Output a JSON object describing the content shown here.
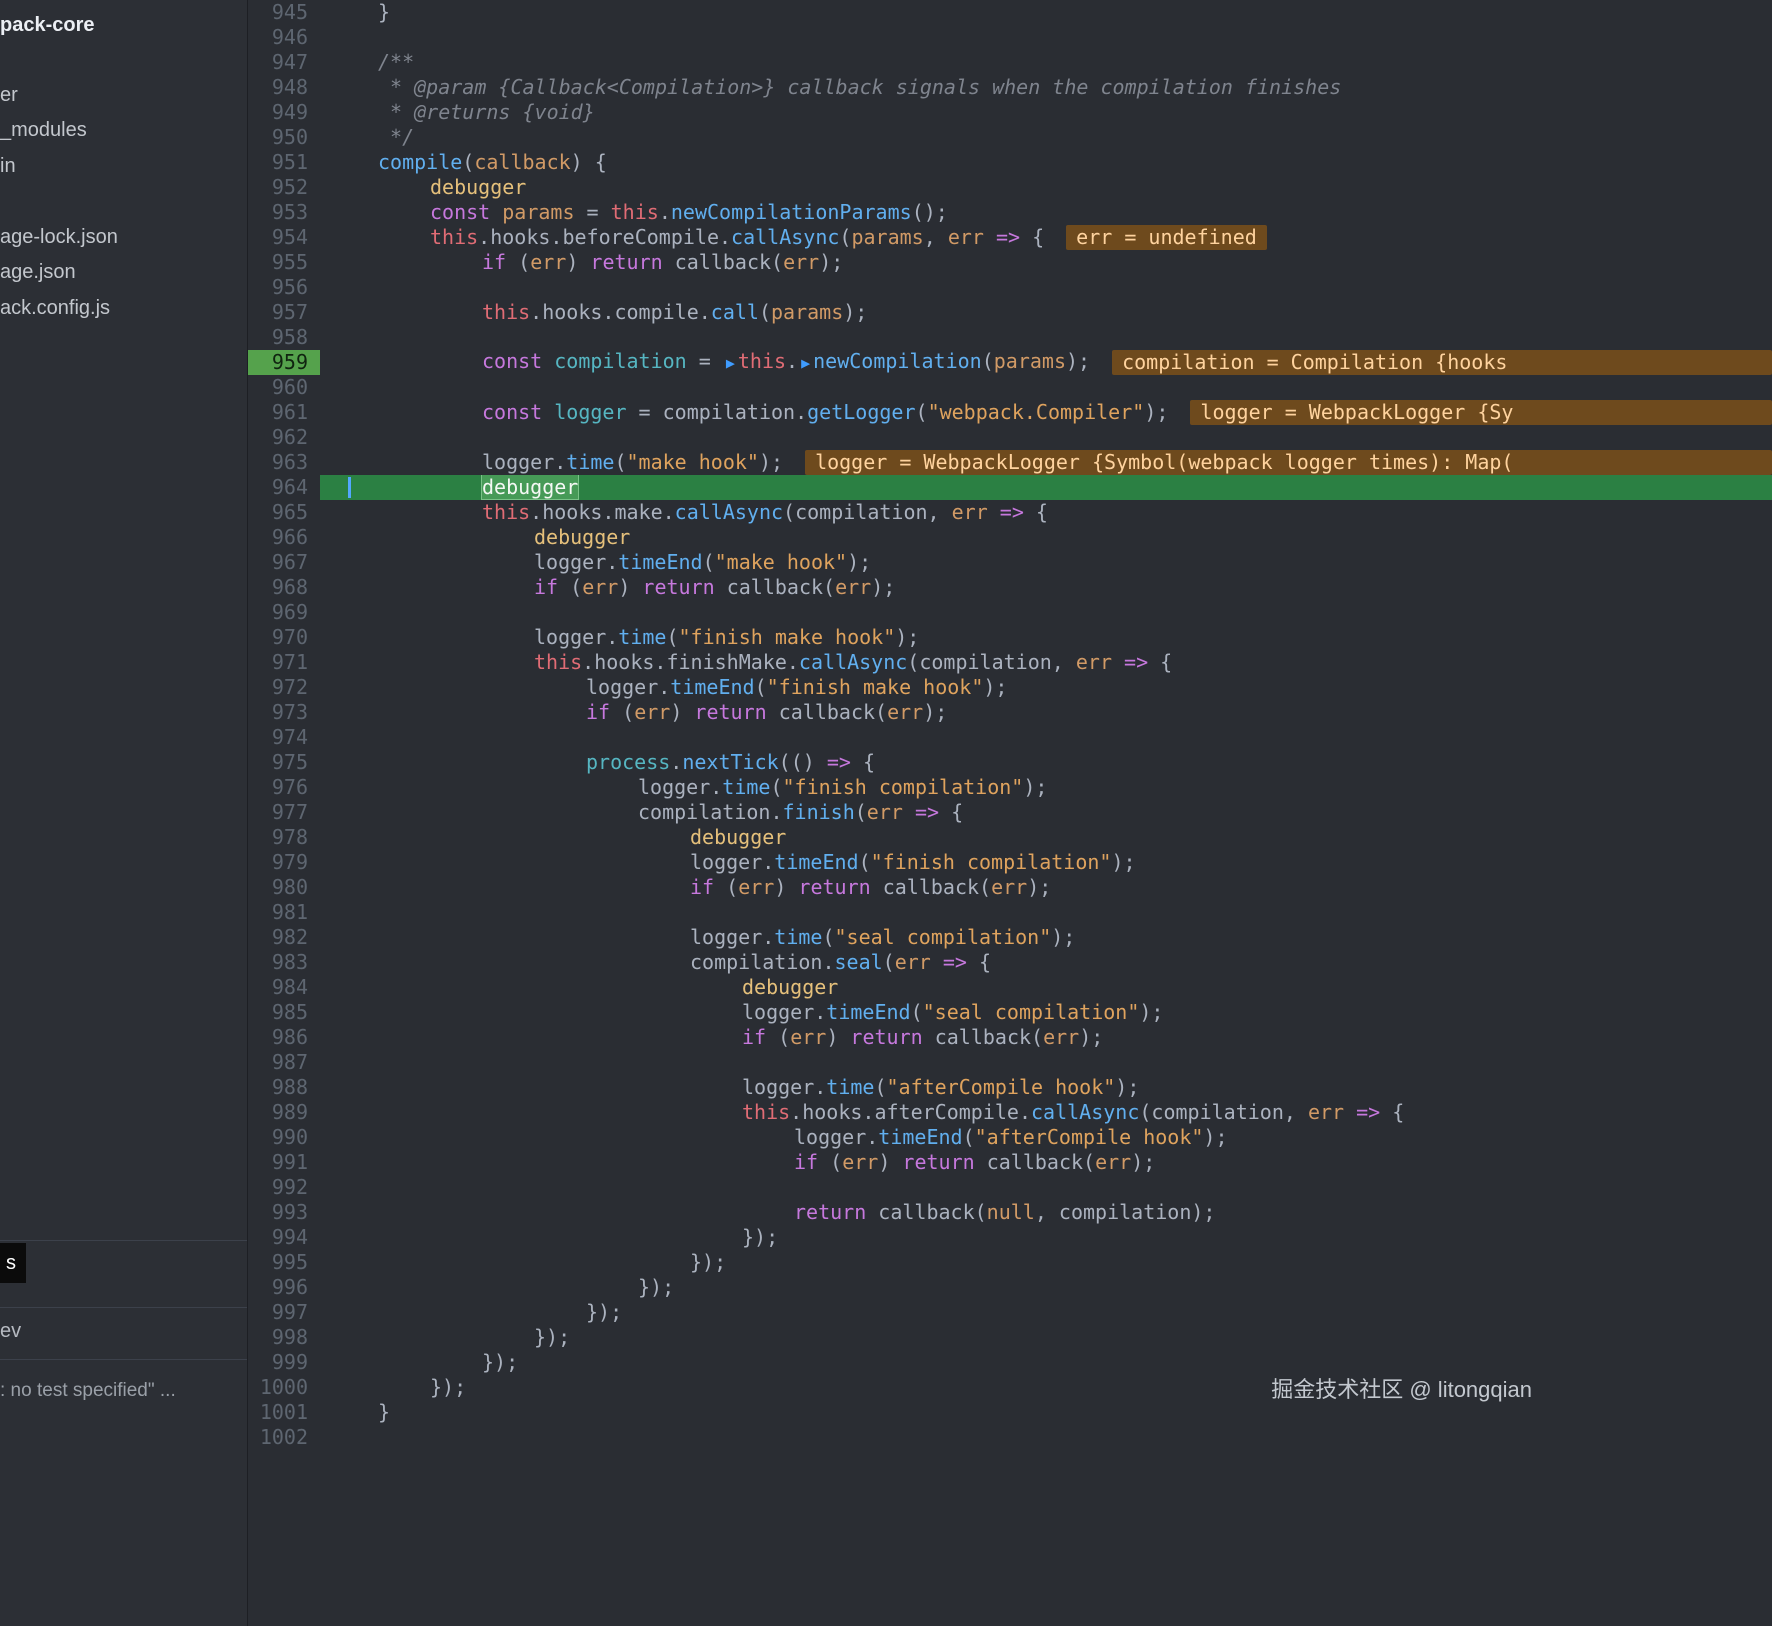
{
  "watermark": "掘金技术社区 @ litongqian",
  "sidebar": {
    "items": [
      {
        "label": "pack-core",
        "bold": true
      },
      {
        "label": "er"
      },
      {
        "label": "_modules"
      },
      {
        "label": "in"
      },
      {
        "label": "age-lock.json"
      },
      {
        "label": "age.json"
      },
      {
        "label": "ack.config.js"
      }
    ],
    "bottom": {
      "tab_label": "s",
      "script_label": "ev",
      "test_label": ": no test specified\" ..."
    }
  },
  "editor": {
    "lines": [
      {
        "n": 945,
        "ind": 1,
        "t": [
          [
            "p",
            "}"
          ]
        ]
      },
      {
        "n": 946,
        "ind": 0,
        "t": []
      },
      {
        "n": 947,
        "ind": 1,
        "t": [
          [
            "cm",
            "/**"
          ]
        ]
      },
      {
        "n": 948,
        "ind": 1,
        "t": [
          [
            "cm",
            " * @param {Callback<Compilation>} callback signals when the compilation finishes"
          ]
        ]
      },
      {
        "n": 949,
        "ind": 1,
        "t": [
          [
            "cm",
            " * @returns {void}"
          ]
        ]
      },
      {
        "n": 950,
        "ind": 1,
        "t": [
          [
            "cm",
            " */"
          ]
        ]
      },
      {
        "n": 951,
        "ind": 1,
        "t": [
          [
            "f",
            "compile"
          ],
          [
            "p",
            "("
          ],
          [
            "o",
            "callback"
          ],
          [
            "p",
            ") {"
          ]
        ]
      },
      {
        "n": 952,
        "ind": 2,
        "t": [
          [
            "d",
            "debugger"
          ]
        ]
      },
      {
        "n": 953,
        "ind": 2,
        "t": [
          [
            "k",
            "const"
          ],
          [
            "p",
            " "
          ],
          [
            "o",
            "params"
          ],
          [
            "p",
            " = "
          ],
          [
            "t",
            "this"
          ],
          [
            "p",
            "."
          ],
          [
            "f",
            "newCompilationParams"
          ],
          [
            "p",
            "();"
          ]
        ]
      },
      {
        "n": 954,
        "ind": 2,
        "t": [
          [
            "t",
            "this"
          ],
          [
            "p",
            ".hooks.beforeCompile."
          ],
          [
            "f",
            "callAsync"
          ],
          [
            "p",
            "("
          ],
          [
            "o",
            "params"
          ],
          [
            "p",
            ", "
          ],
          [
            "o",
            "err"
          ],
          [
            "p",
            " "
          ],
          [
            "k",
            "=>"
          ],
          [
            "p",
            " {"
          ]
        ],
        "a": {
          "text": "err = undefined"
        }
      },
      {
        "n": 955,
        "ind": 3,
        "t": [
          [
            "k",
            "if"
          ],
          [
            "p",
            " ("
          ],
          [
            "o",
            "err"
          ],
          [
            "p",
            ") "
          ],
          [
            "k",
            "return"
          ],
          [
            "p",
            " callback("
          ],
          [
            "o",
            "err"
          ],
          [
            "p",
            ");"
          ]
        ]
      },
      {
        "n": 956,
        "ind": 0,
        "t": []
      },
      {
        "n": 957,
        "ind": 3,
        "t": [
          [
            "t",
            "this"
          ],
          [
            "p",
            ".hooks.compile."
          ],
          [
            "f",
            "call"
          ],
          [
            "p",
            "("
          ],
          [
            "o",
            "params"
          ],
          [
            "p",
            ");"
          ]
        ]
      },
      {
        "n": 958,
        "ind": 0,
        "t": []
      },
      {
        "n": 959,
        "ind": 3,
        "bp": true,
        "t": [
          [
            "k",
            "const"
          ],
          [
            "p",
            " "
          ],
          [
            "c",
            "compilation"
          ],
          [
            "p",
            " = "
          ],
          [
            "m",
            "▶"
          ],
          [
            "t",
            "this"
          ],
          [
            "p",
            "."
          ],
          [
            "m",
            "▶"
          ],
          [
            "f",
            "newCompilation"
          ],
          [
            "p",
            "("
          ],
          [
            "o",
            "params"
          ],
          [
            "p",
            ");"
          ]
        ],
        "a": {
          "text": "compilation = Compilation {hooks",
          "stretch": true
        }
      },
      {
        "n": 960,
        "ind": 0,
        "t": []
      },
      {
        "n": 961,
        "ind": 3,
        "t": [
          [
            "k",
            "const"
          ],
          [
            "p",
            " "
          ],
          [
            "c",
            "logger"
          ],
          [
            "p",
            " = compilation."
          ],
          [
            "f",
            "getLogger"
          ],
          [
            "p",
            "("
          ],
          [
            "s",
            "\"webpack.Compiler\""
          ],
          [
            "p",
            ");"
          ]
        ],
        "a": {
          "text": "logger = WebpackLogger {Sy",
          "stretch": true
        }
      },
      {
        "n": 962,
        "ind": 0,
        "t": []
      },
      {
        "n": 963,
        "ind": 3,
        "t": [
          [
            "p",
            "logger."
          ],
          [
            "f",
            "time"
          ],
          [
            "p",
            "("
          ],
          [
            "s",
            "\"make hook\""
          ],
          [
            "p",
            ");"
          ]
        ],
        "a": {
          "text": "logger = WebpackLogger {Symbol(webpack logger times): Map(",
          "stretch": true
        }
      },
      {
        "n": 964,
        "ind": 3,
        "cur": true,
        "t": [
          [
            "dw",
            "debugger"
          ]
        ]
      },
      {
        "n": 965,
        "ind": 3,
        "t": [
          [
            "t",
            "this"
          ],
          [
            "p",
            ".hooks.make."
          ],
          [
            "f",
            "callAsync"
          ],
          [
            "p",
            "(compilation, "
          ],
          [
            "o",
            "err"
          ],
          [
            "p",
            " "
          ],
          [
            "k",
            "=>"
          ],
          [
            "p",
            " {"
          ]
        ]
      },
      {
        "n": 966,
        "ind": 4,
        "t": [
          [
            "d",
            "debugger"
          ]
        ]
      },
      {
        "n": 967,
        "ind": 4,
        "t": [
          [
            "p",
            "logger."
          ],
          [
            "f",
            "timeEnd"
          ],
          [
            "p",
            "("
          ],
          [
            "s",
            "\"make hook\""
          ],
          [
            "p",
            ");"
          ]
        ]
      },
      {
        "n": 968,
        "ind": 4,
        "t": [
          [
            "k",
            "if"
          ],
          [
            "p",
            " ("
          ],
          [
            "o",
            "err"
          ],
          [
            "p",
            ") "
          ],
          [
            "k",
            "return"
          ],
          [
            "p",
            " callback("
          ],
          [
            "o",
            "err"
          ],
          [
            "p",
            ");"
          ]
        ]
      },
      {
        "n": 969,
        "ind": 0,
        "t": []
      },
      {
        "n": 970,
        "ind": 4,
        "t": [
          [
            "p",
            "logger."
          ],
          [
            "f",
            "time"
          ],
          [
            "p",
            "("
          ],
          [
            "s",
            "\"finish make hook\""
          ],
          [
            "p",
            ");"
          ]
        ]
      },
      {
        "n": 971,
        "ind": 4,
        "t": [
          [
            "t",
            "this"
          ],
          [
            "p",
            ".hooks.finishMake."
          ],
          [
            "f",
            "callAsync"
          ],
          [
            "p",
            "(compilation, "
          ],
          [
            "o",
            "err"
          ],
          [
            "p",
            " "
          ],
          [
            "k",
            "=>"
          ],
          [
            "p",
            " {"
          ]
        ]
      },
      {
        "n": 972,
        "ind": 5,
        "t": [
          [
            "p",
            "logger."
          ],
          [
            "f",
            "timeEnd"
          ],
          [
            "p",
            "("
          ],
          [
            "s",
            "\"finish make hook\""
          ],
          [
            "p",
            ");"
          ]
        ]
      },
      {
        "n": 973,
        "ind": 5,
        "t": [
          [
            "k",
            "if"
          ],
          [
            "p",
            " ("
          ],
          [
            "o",
            "err"
          ],
          [
            "p",
            ") "
          ],
          [
            "k",
            "return"
          ],
          [
            "p",
            " callback("
          ],
          [
            "o",
            "err"
          ],
          [
            "p",
            ");"
          ]
        ]
      },
      {
        "n": 974,
        "ind": 0,
        "t": []
      },
      {
        "n": 975,
        "ind": 5,
        "t": [
          [
            "c",
            "process"
          ],
          [
            "p",
            "."
          ],
          [
            "f",
            "nextTick"
          ],
          [
            "p",
            "(() "
          ],
          [
            "k",
            "=>"
          ],
          [
            "p",
            " {"
          ]
        ]
      },
      {
        "n": 976,
        "ind": 6,
        "t": [
          [
            "p",
            "logger."
          ],
          [
            "f",
            "time"
          ],
          [
            "p",
            "("
          ],
          [
            "s",
            "\"finish compilation\""
          ],
          [
            "p",
            ");"
          ]
        ]
      },
      {
        "n": 977,
        "ind": 6,
        "t": [
          [
            "p",
            "compilation."
          ],
          [
            "f",
            "finish"
          ],
          [
            "p",
            "("
          ],
          [
            "o",
            "err"
          ],
          [
            "p",
            " "
          ],
          [
            "k",
            "=>"
          ],
          [
            "p",
            " {"
          ]
        ]
      },
      {
        "n": 978,
        "ind": 7,
        "t": [
          [
            "d",
            "debugger"
          ]
        ]
      },
      {
        "n": 979,
        "ind": 7,
        "t": [
          [
            "p",
            "logger."
          ],
          [
            "f",
            "timeEnd"
          ],
          [
            "p",
            "("
          ],
          [
            "s",
            "\"finish compilation\""
          ],
          [
            "p",
            ");"
          ]
        ]
      },
      {
        "n": 980,
        "ind": 7,
        "t": [
          [
            "k",
            "if"
          ],
          [
            "p",
            " ("
          ],
          [
            "o",
            "err"
          ],
          [
            "p",
            ") "
          ],
          [
            "k",
            "return"
          ],
          [
            "p",
            " callback("
          ],
          [
            "o",
            "err"
          ],
          [
            "p",
            ");"
          ]
        ]
      },
      {
        "n": 981,
        "ind": 0,
        "t": []
      },
      {
        "n": 982,
        "ind": 7,
        "t": [
          [
            "p",
            "logger."
          ],
          [
            "f",
            "time"
          ],
          [
            "p",
            "("
          ],
          [
            "s",
            "\"seal compilation\""
          ],
          [
            "p",
            ");"
          ]
        ]
      },
      {
        "n": 983,
        "ind": 7,
        "t": [
          [
            "p",
            "compilation."
          ],
          [
            "f",
            "seal"
          ],
          [
            "p",
            "("
          ],
          [
            "o",
            "err"
          ],
          [
            "p",
            " "
          ],
          [
            "k",
            "=>"
          ],
          [
            "p",
            " {"
          ]
        ]
      },
      {
        "n": 984,
        "ind": 8,
        "t": [
          [
            "d",
            "debugger"
          ]
        ]
      },
      {
        "n": 985,
        "ind": 8,
        "t": [
          [
            "p",
            "logger."
          ],
          [
            "f",
            "timeEnd"
          ],
          [
            "p",
            "("
          ],
          [
            "s",
            "\"seal compilation\""
          ],
          [
            "p",
            ");"
          ]
        ]
      },
      {
        "n": 986,
        "ind": 8,
        "t": [
          [
            "k",
            "if"
          ],
          [
            "p",
            " ("
          ],
          [
            "o",
            "err"
          ],
          [
            "p",
            ") "
          ],
          [
            "k",
            "return"
          ],
          [
            "p",
            " callback("
          ],
          [
            "o",
            "err"
          ],
          [
            "p",
            ");"
          ]
        ]
      },
      {
        "n": 987,
        "ind": 0,
        "t": []
      },
      {
        "n": 988,
        "ind": 8,
        "t": [
          [
            "p",
            "logger."
          ],
          [
            "f",
            "time"
          ],
          [
            "p",
            "("
          ],
          [
            "s",
            "\"afterCompile hook\""
          ],
          [
            "p",
            ");"
          ]
        ]
      },
      {
        "n": 989,
        "ind": 8,
        "t": [
          [
            "t",
            "this"
          ],
          [
            "p",
            ".hooks.afterCompile."
          ],
          [
            "f",
            "callAsync"
          ],
          [
            "p",
            "(compilation, "
          ],
          [
            "o",
            "err"
          ],
          [
            "p",
            " "
          ],
          [
            "k",
            "=>"
          ],
          [
            "p",
            " {"
          ]
        ]
      },
      {
        "n": 990,
        "ind": 9,
        "t": [
          [
            "p",
            "logger."
          ],
          [
            "f",
            "timeEnd"
          ],
          [
            "p",
            "("
          ],
          [
            "s",
            "\"afterCompile hook\""
          ],
          [
            "p",
            ");"
          ]
        ]
      },
      {
        "n": 991,
        "ind": 9,
        "t": [
          [
            "k",
            "if"
          ],
          [
            "p",
            " ("
          ],
          [
            "o",
            "err"
          ],
          [
            "p",
            ") "
          ],
          [
            "k",
            "return"
          ],
          [
            "p",
            " callback("
          ],
          [
            "o",
            "err"
          ],
          [
            "p",
            ");"
          ]
        ]
      },
      {
        "n": 992,
        "ind": 0,
        "t": []
      },
      {
        "n": 993,
        "ind": 9,
        "t": [
          [
            "k",
            "return"
          ],
          [
            "p",
            " callback("
          ],
          [
            "o",
            "null"
          ],
          [
            "p",
            ", compilation);"
          ]
        ]
      },
      {
        "n": 994,
        "ind": 8,
        "t": [
          [
            "p",
            "});"
          ]
        ]
      },
      {
        "n": 995,
        "ind": 7,
        "t": [
          [
            "p",
            "});"
          ]
        ]
      },
      {
        "n": 996,
        "ind": 6,
        "t": [
          [
            "p",
            "});"
          ]
        ]
      },
      {
        "n": 997,
        "ind": 5,
        "t": [
          [
            "p",
            "});"
          ]
        ]
      },
      {
        "n": 998,
        "ind": 4,
        "t": [
          [
            "p",
            "});"
          ]
        ]
      },
      {
        "n": 999,
        "ind": 3,
        "t": [
          [
            "p",
            "});"
          ]
        ]
      },
      {
        "n": 1000,
        "ind": 2,
        "t": [
          [
            "p",
            "});"
          ]
        ]
      },
      {
        "n": 1001,
        "ind": 1,
        "t": [
          [
            "p",
            "}"
          ]
        ]
      },
      {
        "n": 1002,
        "ind": 0,
        "t": []
      }
    ]
  },
  "colors": {
    "editor_bg": "#2a2d33",
    "current_line_green": "#2b8043",
    "breakpoint_gutter_green": "#55a24c",
    "inline_value_bg": "#6e4a1d",
    "inline_value_text": "#ffd39e",
    "keyword": "#c678dd",
    "function": "#61afef",
    "string": "#dfa35e",
    "this_keyword": "#e06c75"
  }
}
